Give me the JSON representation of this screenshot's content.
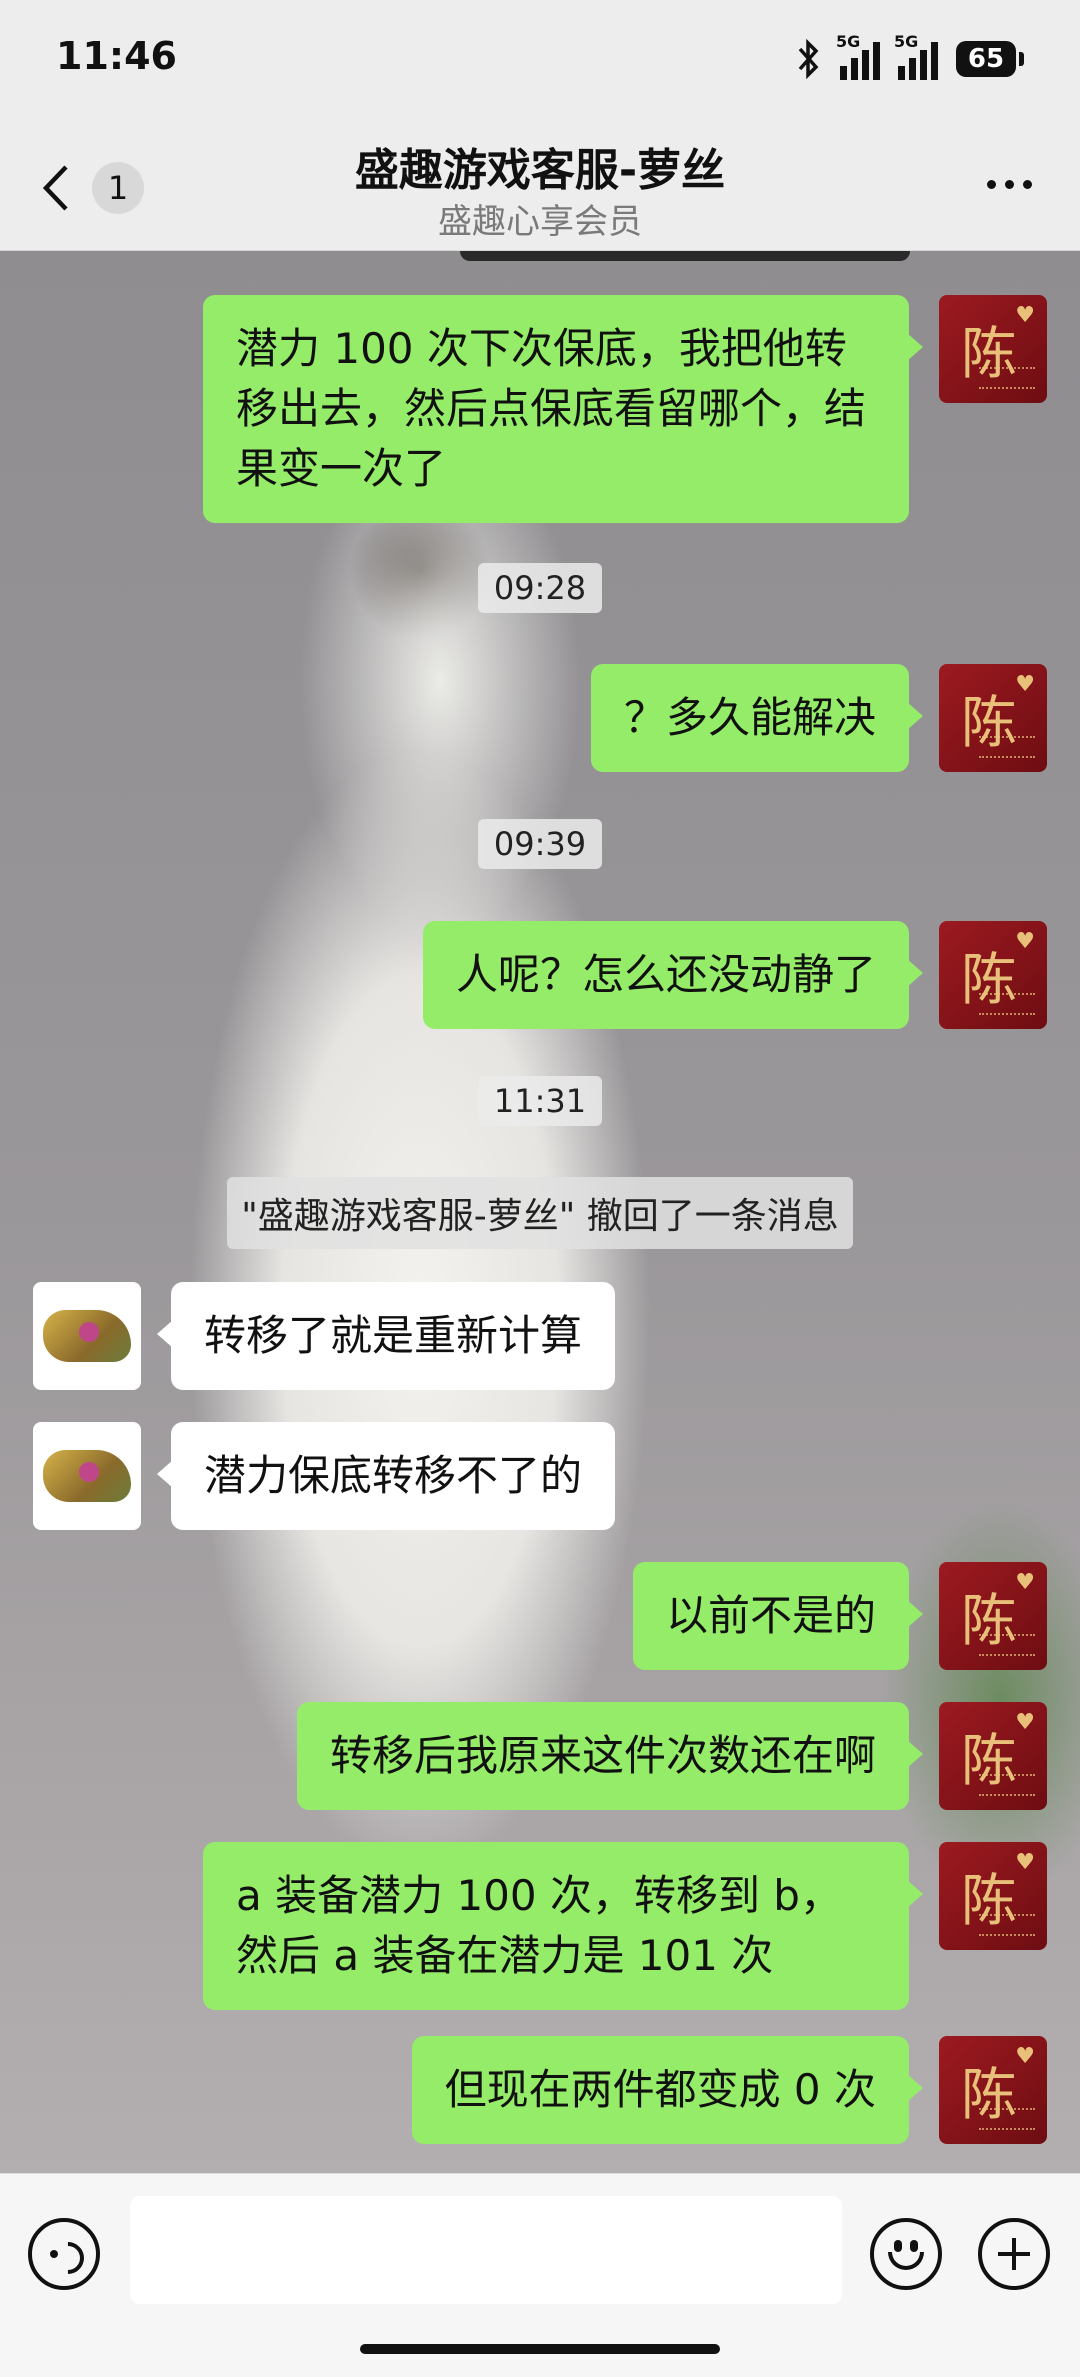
{
  "status_bar": {
    "time": "11:46",
    "signal1_label": "5G",
    "signal2_label": "5G",
    "battery": "65"
  },
  "nav": {
    "unread_count": "1",
    "title": "盛趣游戏客服-萝丝",
    "subtitle": "盛趣心享会员"
  },
  "avatars": {
    "me_glyph": "陈",
    "me_heart": "♥"
  },
  "messages": [
    {
      "text": "潜力 100 次下次保底，我把他转移出去，然后点保底看留哪个，结果变一次了"
    },
    {
      "text": "？多久能解决"
    },
    {
      "text": "人呢？怎么还没动静了"
    },
    {
      "text": "转移了就是重新计算"
    },
    {
      "text": "潜力保底转移不了的"
    },
    {
      "text": "以前不是的"
    },
    {
      "text": "转移后我原来这件次数还在啊"
    },
    {
      "text": "a 装备潜力 100 次，转移到 b，然后 a 装备在潜力是 101 次"
    },
    {
      "text": "但现在两件都变成 0 次"
    }
  ],
  "timestamps": [
    "09:28",
    "09:39",
    "11:31"
  ],
  "system_notice": "\"盛趣游戏客服-萝丝\" 撤回了一条消息",
  "input": {
    "placeholder": ""
  }
}
